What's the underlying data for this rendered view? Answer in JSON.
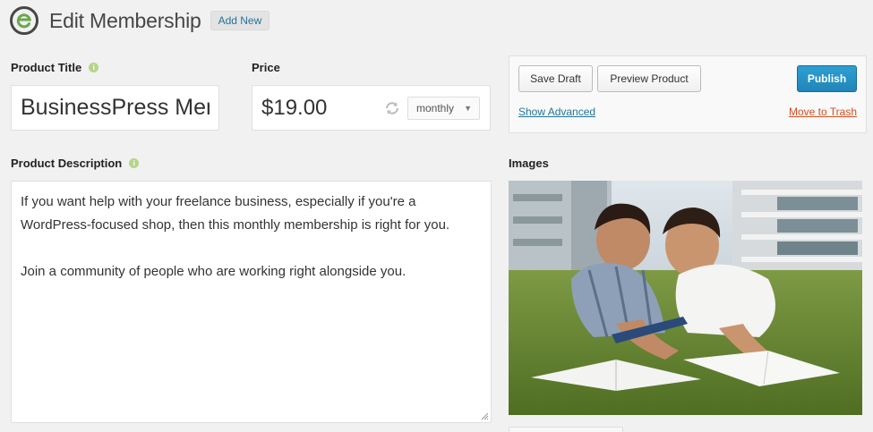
{
  "header": {
    "title": "Edit Membership",
    "add_new_label": "Add New"
  },
  "product_title": {
    "label": "Product Title",
    "value": "BusinessPress Membership"
  },
  "price": {
    "label": "Price",
    "value": "$19.00",
    "period": "monthly"
  },
  "publish": {
    "save_draft_label": "Save Draft",
    "preview_label": "Preview Product",
    "publish_label": "Publish",
    "show_advanced_label": "Show Advanced",
    "trash_label": "Move to Trash"
  },
  "description": {
    "label": "Product Description",
    "paragraph_1": "If you want help with your freelance business, especially if you're a WordPress-focused shop, then this monthly membership is right for you.",
    "paragraph_2": "Join a community of people who are working right alongside you."
  },
  "images": {
    "label": "Images"
  },
  "colors": {
    "accent": "#21759b",
    "publish": "#2185b8",
    "danger": "#d54e21",
    "info_dot": "#b6d489"
  }
}
